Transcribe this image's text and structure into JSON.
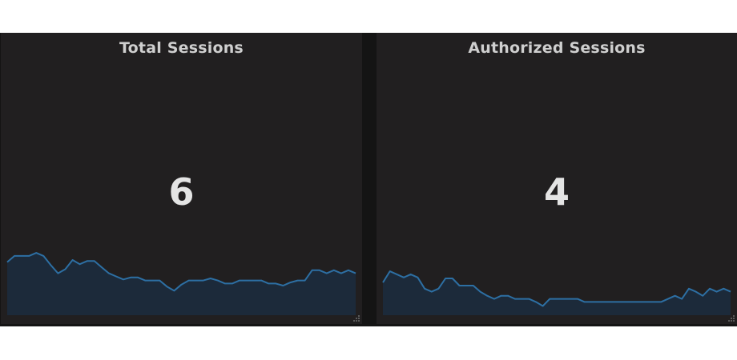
{
  "colors": {
    "panel_bg": "#211f20",
    "sparkline_line": "#2d6fa3",
    "sparkline_fill": "#1c2a3a",
    "title_text": "#cfcfcf",
    "value_text": "#e4e4e4"
  },
  "panels": [
    {
      "title": "Total Sessions",
      "value": "6",
      "sparkline": [
        5.2,
        5.8,
        5.8,
        5.8,
        6.1,
        5.8,
        4.9,
        4.1,
        4.5,
        5.4,
        5.0,
        5.3,
        5.3,
        4.7,
        4.1,
        3.8,
        3.5,
        3.7,
        3.7,
        3.4,
        3.4,
        3.4,
        2.8,
        2.4,
        3.0,
        3.4,
        3.4,
        3.4,
        3.6,
        3.4,
        3.1,
        3.1,
        3.4,
        3.4,
        3.4,
        3.4,
        3.1,
        3.1,
        2.9,
        3.2,
        3.4,
        3.4,
        4.4,
        4.4,
        4.1,
        4.4,
        4.1,
        4.4,
        4.1
      ]
    },
    {
      "title": "Authorized Sessions",
      "value": "4",
      "sparkline": [
        3.2,
        4.3,
        4.0,
        3.7,
        4.0,
        3.7,
        2.6,
        2.3,
        2.6,
        3.6,
        3.6,
        2.9,
        2.9,
        2.9,
        2.3,
        1.9,
        1.6,
        1.9,
        1.9,
        1.6,
        1.6,
        1.6,
        1.3,
        0.9,
        1.6,
        1.6,
        1.6,
        1.6,
        1.6,
        1.3,
        1.3,
        1.3,
        1.3,
        1.3,
        1.3,
        1.3,
        1.3,
        1.3,
        1.3,
        1.3,
        1.3,
        1.6,
        1.9,
        1.6,
        2.6,
        2.3,
        1.9,
        2.6,
        2.3,
        2.6,
        2.3
      ]
    }
  ]
}
